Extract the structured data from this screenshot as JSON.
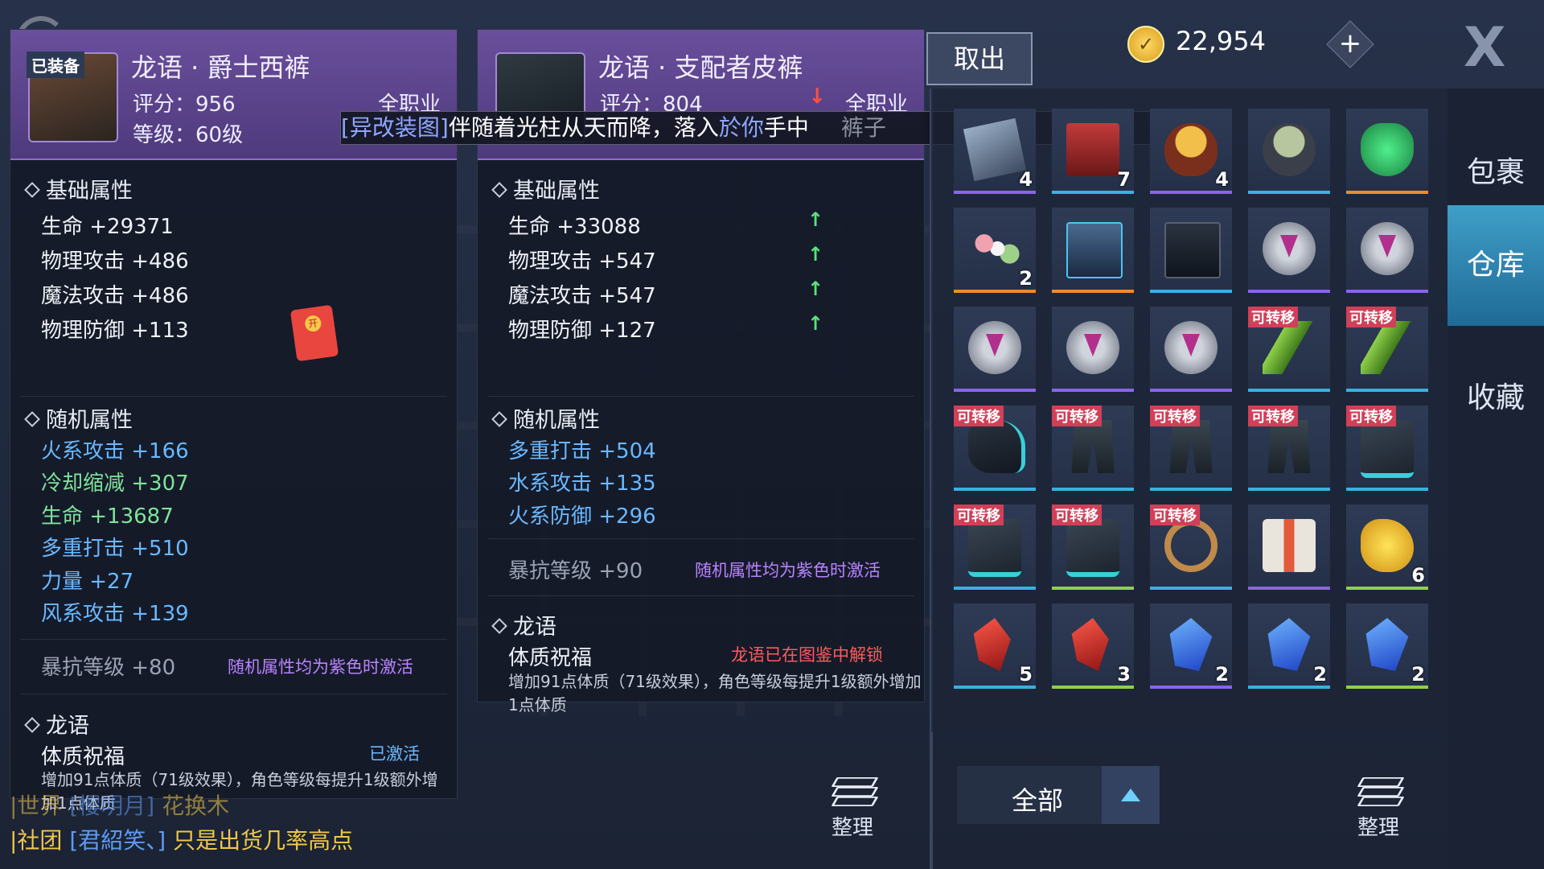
{
  "left_item": {
    "equipped_tag": "已装备",
    "name": "龙语 · 爵士西裤",
    "score": "评分：956",
    "level": "等级：60级",
    "class": "全职业",
    "base_title": "基础属性",
    "base_stats": [
      "生命 +29371",
      "物理攻击 +486",
      "魔法攻击 +486",
      "物理防御 +113"
    ],
    "random_title": "随机属性",
    "random_stats": [
      "火系攻击 +166",
      "冷却缩减 +307",
      "生命 +13687",
      "多重打击 +510",
      "力量 +27",
      "风系攻击 +139"
    ],
    "crit_resist": "暴抗等级 +80",
    "crit_note": "随机属性均为紫色时激活",
    "dragon_title": "龙语",
    "dragon_skill": "体质祝福",
    "dragon_status": "已激活",
    "dragon_desc": "增加91点体质（71级效果），角色等级每提升1级额外增加1点体质"
  },
  "right_item": {
    "name": "龙语 · 支配者皮裤",
    "score": "评分：804",
    "score_arrow": "↓",
    "class": "全职业",
    "base_title": "基础属性",
    "base_stats": [
      "生命 +33088",
      "物理攻击 +547",
      "魔法攻击 +547",
      "物理防御 +127"
    ],
    "random_title": "随机属性",
    "random_stats": [
      "多重打击 +504",
      "水系攻击 +135",
      "火系防御 +296"
    ],
    "crit_resist": "暴抗等级 +90",
    "crit_note": "随机属性均为紫色时激活",
    "dragon_title": "龙语",
    "dragon_skill": "体质祝福",
    "dragon_status": "龙语已在图鉴中解锁",
    "dragon_desc": "增加91点体质（71级效果），角色等级每提升1级额外增加1点体质",
    "up_arrow": "↑"
  },
  "banner": {
    "tag": "[异改装图]",
    "text": "伴随着光柱从天而降，落入",
    "you": "於你",
    "end": "手中",
    "faint_right": "裤子"
  },
  "chat": [
    {
      "channel": "|世界",
      "name": "[樱明月]",
      "msg": "花换木"
    },
    {
      "channel": "|社团",
      "name": "[君紹笑、]",
      "msg": "只是出货几率高点"
    }
  ],
  "header": {
    "takeout": "取出",
    "coins": "22,954",
    "coin_icon": "coin-icon",
    "plus": "+",
    "close": "X"
  },
  "tabs": [
    {
      "label": "包裹",
      "active": false
    },
    {
      "label": "仓库",
      "active": true
    },
    {
      "label": "收藏",
      "active": false
    }
  ],
  "transfer_label": "可转移",
  "inventory": [
    {
      "icon": "card",
      "count": "4",
      "color": "#8a64e8",
      "transfer": false
    },
    {
      "icon": "cake",
      "count": "7",
      "color": "#3ab0e0",
      "transfer": false
    },
    {
      "icon": "bowl",
      "count": "4",
      "color": "#8a64e8",
      "transfer": false
    },
    {
      "icon": "pot",
      "count": "",
      "color": "#3ab0e0",
      "transfer": false
    },
    {
      "icon": "potion",
      "count": "",
      "color": "#f08a2a",
      "transfer": false
    },
    {
      "icon": "dango",
      "count": "2",
      "color": "#f08a2a",
      "transfer": false
    },
    {
      "icon": "chest",
      "count": "",
      "color": "#f08a2a",
      "transfer": false
    },
    {
      "icon": "chest-dark",
      "count": "",
      "color": "#3ab0e0",
      "transfer": false
    },
    {
      "icon": "gear",
      "count": "",
      "color": "#8a64e8",
      "transfer": false
    },
    {
      "icon": "gear",
      "count": "",
      "color": "#8a64e8",
      "transfer": false
    },
    {
      "icon": "gear",
      "count": "",
      "color": "#8a64e8",
      "transfer": false
    },
    {
      "icon": "gear",
      "count": "",
      "color": "#8a64e8",
      "transfer": false
    },
    {
      "icon": "gear",
      "count": "",
      "color": "#8a64e8",
      "transfer": false
    },
    {
      "icon": "dragonfly",
      "count": "",
      "color": "#3ab0e0",
      "transfer": true
    },
    {
      "icon": "dragonfly",
      "count": "",
      "color": "#3ab0e0",
      "transfer": true
    },
    {
      "icon": "glove",
      "count": "",
      "color": "#3ab0e0",
      "transfer": true
    },
    {
      "icon": "pants",
      "count": "",
      "color": "#3ab0e0",
      "transfer": true
    },
    {
      "icon": "pants",
      "count": "",
      "color": "#3ab0e0",
      "transfer": true
    },
    {
      "icon": "pants",
      "count": "",
      "color": "#3ab0e0",
      "transfer": true
    },
    {
      "icon": "boots",
      "count": "",
      "color": "#3ab0e0",
      "transfer": true
    },
    {
      "icon": "boots",
      "count": "",
      "color": "#3ab0e0",
      "transfer": true
    },
    {
      "icon": "boots",
      "count": "",
      "color": "#8fd04a",
      "transfer": true
    },
    {
      "icon": "bracelet",
      "count": "",
      "color": "#3ab0e0",
      "transfer": true
    },
    {
      "icon": "gift",
      "count": "",
      "color": "#8a64e8",
      "transfer": false
    },
    {
      "icon": "gold",
      "count": "6",
      "color": "#8fd04a",
      "transfer": false
    },
    {
      "icon": "crystal-red",
      "count": "5",
      "color": "#3ab0e0",
      "transfer": false
    },
    {
      "icon": "crystal-red",
      "count": "3",
      "color": "#8fd04a",
      "transfer": false
    },
    {
      "icon": "crystal-blue",
      "count": "2",
      "color": "#8a64e8",
      "transfer": false
    },
    {
      "icon": "crystal-blue",
      "count": "2",
      "color": "#3ab0e0",
      "transfer": false
    },
    {
      "icon": "crystal-blue",
      "count": "2",
      "color": "#8fd04a",
      "transfer": false
    }
  ],
  "bottom": {
    "filter": "全部",
    "sort_label": "整理"
  }
}
